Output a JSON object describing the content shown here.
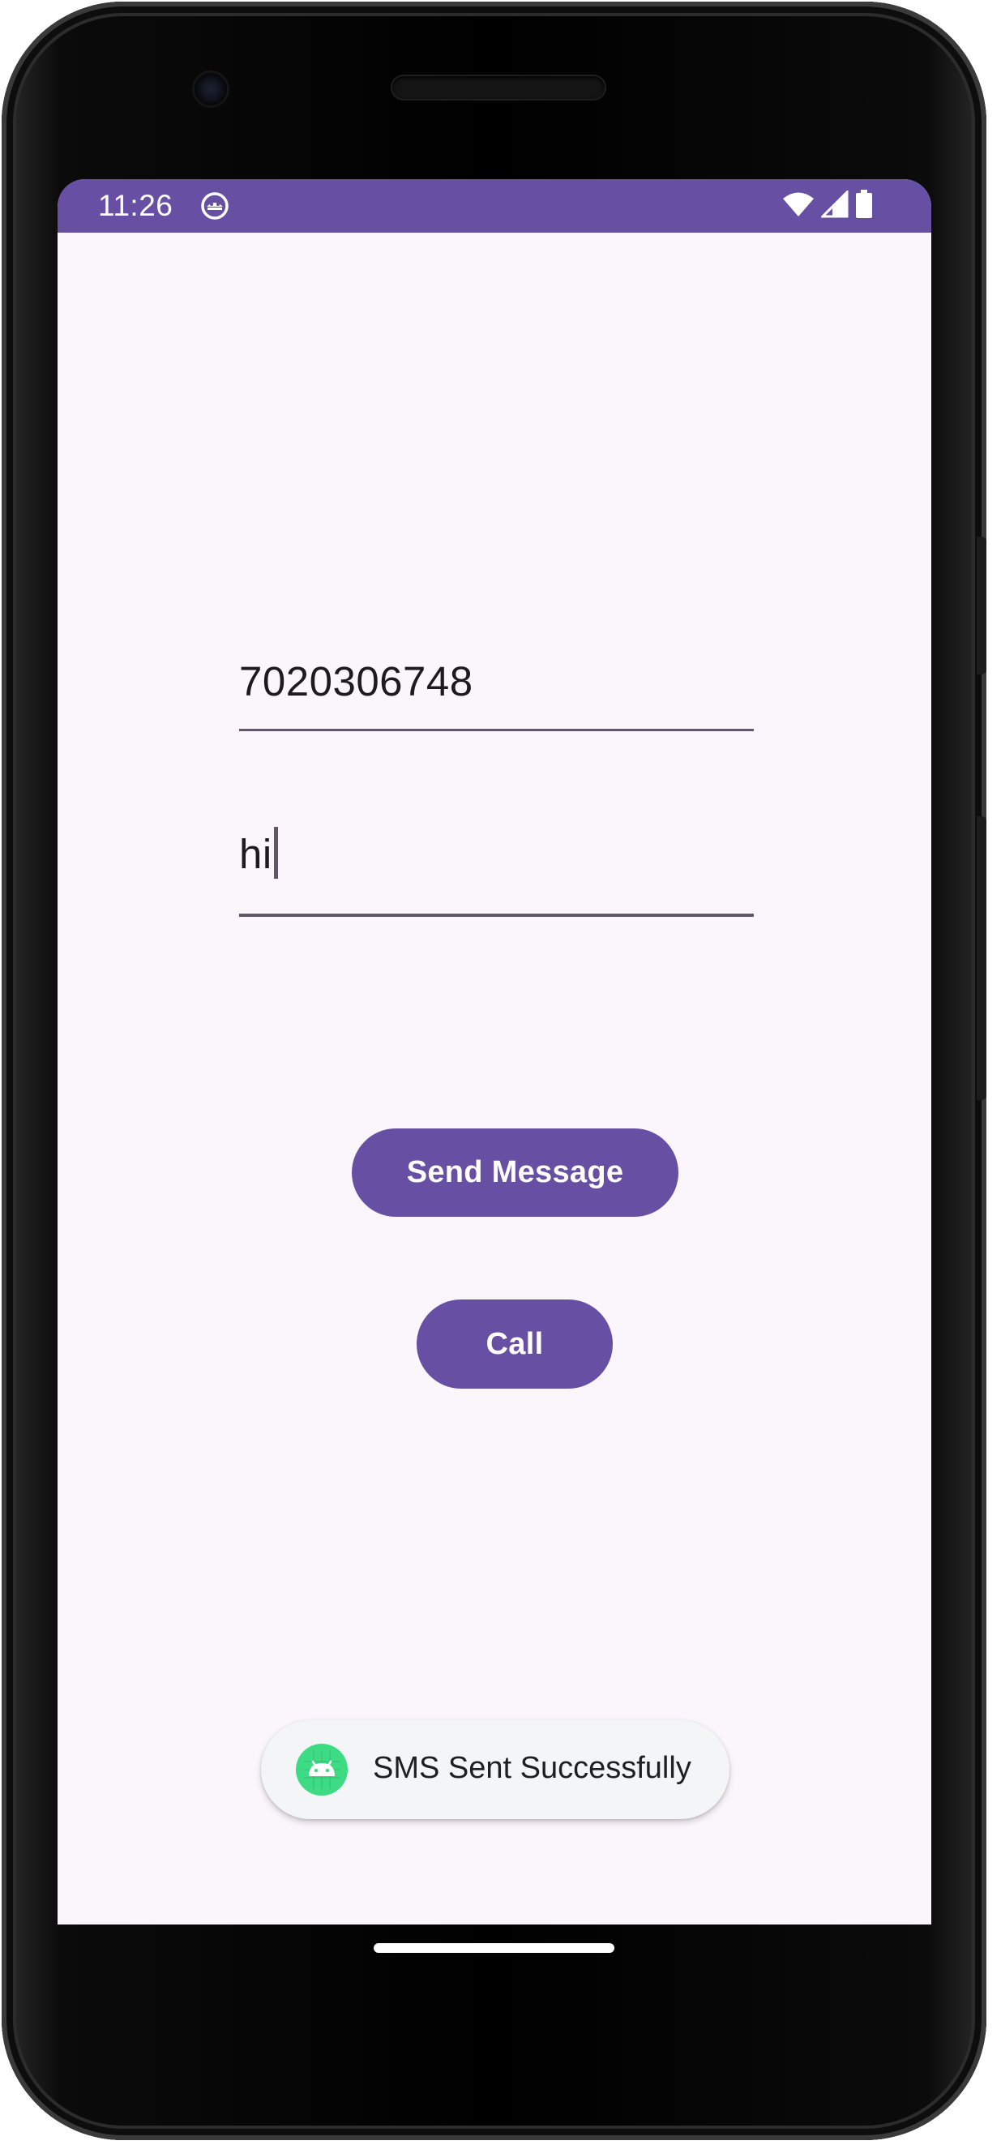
{
  "status_bar": {
    "time": "11:26",
    "app_icon": "android-debug-icon",
    "icons": [
      "wifi-icon",
      "cellular-signal-icon",
      "battery-icon"
    ],
    "color": "#6750a4"
  },
  "form": {
    "phone_value": "7020306748",
    "message_value": "hi"
  },
  "buttons": {
    "send_label": "Send Message",
    "call_label": "Call",
    "color": "#6750a4"
  },
  "toast": {
    "icon": "android-icon",
    "text": "SMS Sent Successfully"
  },
  "colors": {
    "background": "#fbf5fc",
    "accent": "#6750a4",
    "text": "#1d1b20"
  }
}
